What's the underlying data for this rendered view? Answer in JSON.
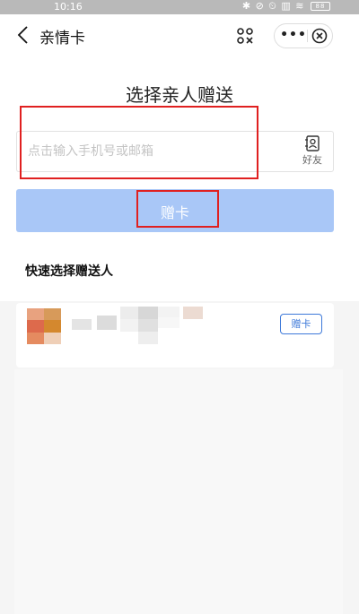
{
  "status_bar": {
    "time": "10:16",
    "icons": "✱ ⊘ ⏲ ▥ ≋",
    "battery": "88"
  },
  "nav": {
    "title": "亲情卡",
    "more_label": "•••"
  },
  "heading": "选择亲人赠送",
  "input": {
    "placeholder": "点击输入手机号或邮箱",
    "friend_label": "好友"
  },
  "gift_button_label": "赠卡",
  "quick_select": {
    "title": "快速选择赠送人",
    "contacts": [
      {
        "action_label": "赠卡"
      }
    ]
  },
  "colors": {
    "accent": "#3d79d9",
    "button_disabled": "#a9c7f7",
    "annotation": "#e02020"
  }
}
